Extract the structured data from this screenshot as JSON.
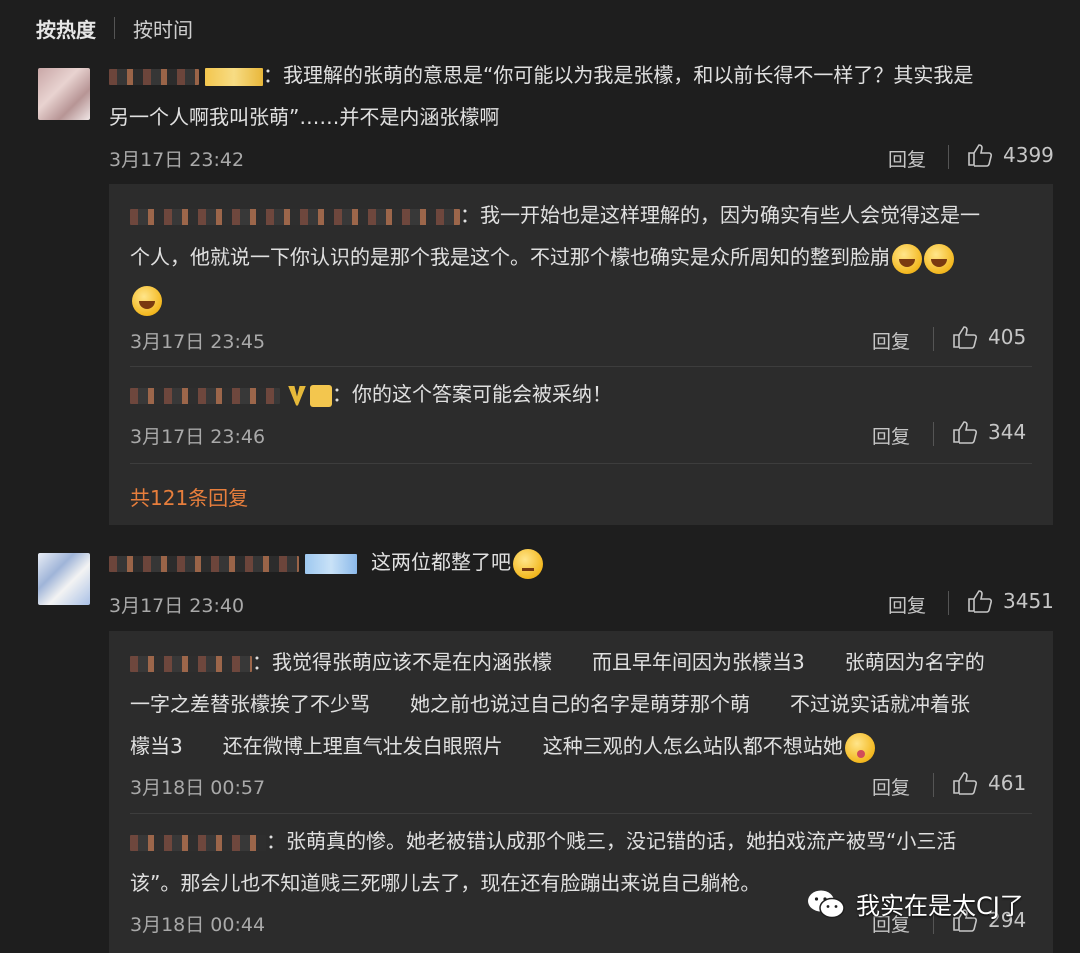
{
  "sort": {
    "active": "按热度",
    "other": "按时间"
  },
  "comments": [
    {
      "text_line1": "：我理解的张萌的意思是“你可能以为我是张檬，和以前长得不一样了？其实我是",
      "text_line2": "另一个人啊我叫张萌”……并不是内涵张檬啊",
      "time": "3月17日 23:42",
      "reply_label": "回复",
      "likes": "4399",
      "replies": [
        {
          "text_line1": "：我一开始也是这样理解的，因为确实有些人会觉得这是一",
          "text_line2": "个人，他就说一下你认识的是那个我是这个。不过那个檬也确实是众所周知的整到脸崩",
          "time": "3月17日 23:45",
          "reply_label": "回复",
          "likes": "405"
        },
        {
          "text_line1": "：你的这个答案可能会被采纳！",
          "time": "3月17日 23:46",
          "reply_label": "回复",
          "likes": "344"
        }
      ],
      "more_replies": "共121条回复"
    },
    {
      "text_line1": "这两位都整了吧",
      "time": "3月17日 23:40",
      "reply_label": "回复",
      "likes": "3451",
      "replies": [
        {
          "text_line1": "：我觉得张萌应该不是在内涵张檬　　而且早年间因为张檬当3　　张萌因为名字的",
          "text_line2": "一字之差替张檬挨了不少骂　　她之前也说过自己的名字是萌芽那个萌　　不过说实话就冲着张",
          "text_line3": "檬当3　　还在微博上理直气壮发白眼照片　　这种三观的人怎么站队都不想站她",
          "time": "3月18日 00:57",
          "reply_label": "回复",
          "likes": "461"
        },
        {
          "text_line1": "：张萌真的惨。她老被错认成那个贱三，没记错的话，她拍戏流产被骂“小三活",
          "text_line2": "该”。那会儿也不知道贱三死哪儿去了，现在还有脸蹦出来说自己躺枪。",
          "time": "3月18日 00:44",
          "reply_label": "回复",
          "likes": "294"
        }
      ]
    }
  ],
  "watermark": "我实在是太CJ了",
  "colors": {
    "background": "#1e1e1e",
    "reply_box": "#2c2c2c",
    "accent": "#e77e3c"
  }
}
